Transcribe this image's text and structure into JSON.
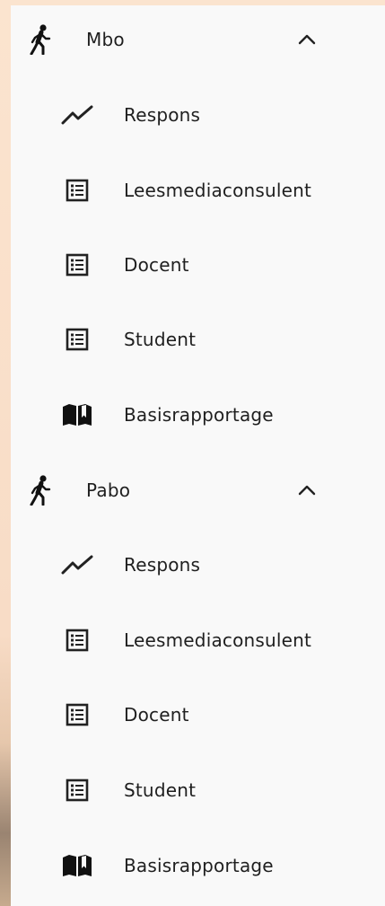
{
  "nav": {
    "groups": [
      {
        "label": "Mbo",
        "icon": "walking-person-icon",
        "expand_icon": "chevron-up-icon",
        "items": [
          {
            "label": "Respons",
            "icon": "line-chart-icon"
          },
          {
            "label": "Leesmediaconsulent",
            "icon": "list-icon"
          },
          {
            "label": "Docent",
            "icon": "list-icon"
          },
          {
            "label": "Student",
            "icon": "list-icon"
          },
          {
            "label": "Basisrapportage",
            "icon": "book-icon"
          }
        ]
      },
      {
        "label": "Pabo",
        "icon": "walking-person-icon",
        "expand_icon": "chevron-up-icon",
        "items": [
          {
            "label": "Respons",
            "icon": "line-chart-icon"
          },
          {
            "label": "Leesmediaconsulent",
            "icon": "list-icon"
          },
          {
            "label": "Docent",
            "icon": "list-icon"
          },
          {
            "label": "Student",
            "icon": "list-icon"
          },
          {
            "label": "Basisrapportage",
            "icon": "book-icon"
          }
        ]
      }
    ]
  }
}
